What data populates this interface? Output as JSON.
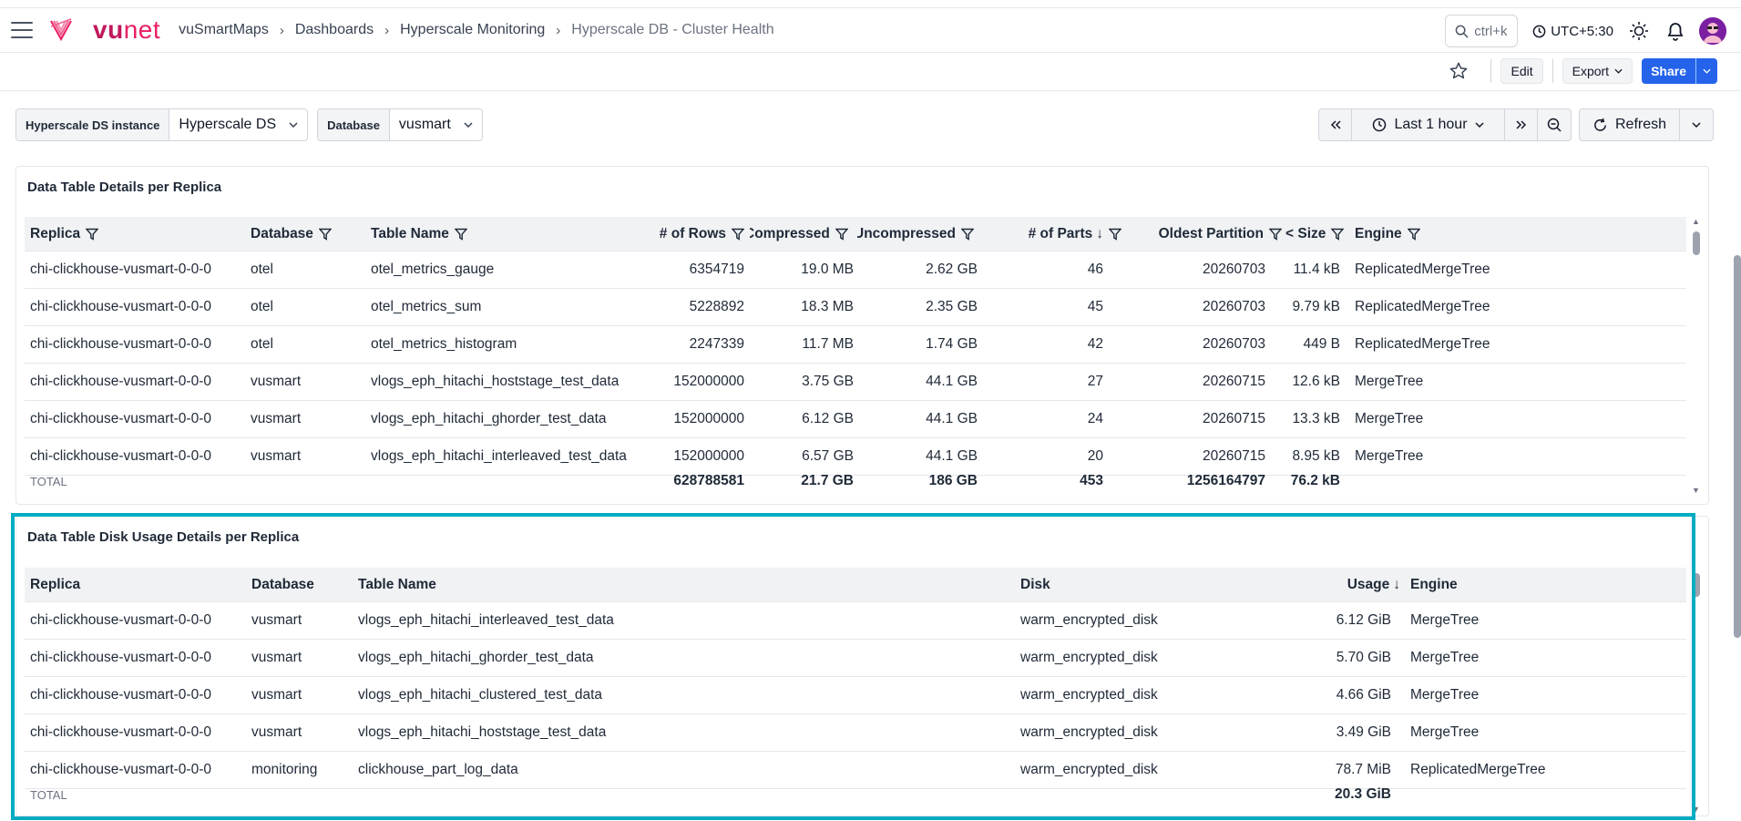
{
  "brand": {
    "name_a": "vu",
    "name_b": "net"
  },
  "breadcrumb": [
    "vuSmartMaps",
    "Dashboards",
    "Hyperscale Monitoring",
    "Hyperscale DB - Cluster Health"
  ],
  "topbar": {
    "search_hint": "ctrl+k",
    "timezone": "UTC+5:30"
  },
  "toolbar": {
    "edit": "Edit",
    "export": "Export",
    "share": "Share"
  },
  "filters": [
    {
      "label": "Hyperscale DS instance",
      "value": "Hyperscale DS"
    },
    {
      "label": "Database",
      "value": "vusmart"
    }
  ],
  "time": {
    "range": "Last 1 hour",
    "refresh": "Refresh"
  },
  "panel1": {
    "title": "Data Table Details per Replica",
    "headers": [
      "Replica",
      "Database",
      "Table Name",
      "# of Rows",
      "Compressed",
      "Uncompressed",
      "# of Parts",
      "Oldest Partition",
      "< Size",
      "Engine"
    ],
    "rows": [
      [
        "chi-clickhouse-vusmart-0-0-0",
        "otel",
        "otel_metrics_gauge",
        "6354719",
        "19.0 MB",
        "2.62 GB",
        "46",
        "20260703",
        "11.4 kB",
        "ReplicatedMergeTree"
      ],
      [
        "chi-clickhouse-vusmart-0-0-0",
        "otel",
        "otel_metrics_sum",
        "5228892",
        "18.3 MB",
        "2.35 GB",
        "45",
        "20260703",
        "9.79 kB",
        "ReplicatedMergeTree"
      ],
      [
        "chi-clickhouse-vusmart-0-0-0",
        "otel",
        "otel_metrics_histogram",
        "2247339",
        "11.7 MB",
        "1.74 GB",
        "42",
        "20260703",
        "449 B",
        "ReplicatedMergeTree"
      ],
      [
        "chi-clickhouse-vusmart-0-0-0",
        "vusmart",
        "vlogs_eph_hitachi_hoststage_test_data",
        "152000000",
        "3.75 GB",
        "44.1 GB",
        "27",
        "20260715",
        "12.6 kB",
        "MergeTree"
      ],
      [
        "chi-clickhouse-vusmart-0-0-0",
        "vusmart",
        "vlogs_eph_hitachi_ghorder_test_data",
        "152000000",
        "6.12 GB",
        "44.1 GB",
        "24",
        "20260715",
        "13.3 kB",
        "MergeTree"
      ],
      [
        "chi-clickhouse-vusmart-0-0-0",
        "vusmart",
        "vlogs_eph_hitachi_interleaved_test_data",
        "152000000",
        "6.57 GB",
        "44.1 GB",
        "20",
        "20260715",
        "8.95 kB",
        "MergeTree"
      ]
    ],
    "total": {
      "label": "TOTAL",
      "rows": "628788581",
      "compressed": "21.7 GB",
      "uncompressed": "186 GB",
      "parts": "453",
      "oldest": "1256164797",
      "size": "76.2 kB"
    }
  },
  "panel2": {
    "title": "Data Table Disk Usage Details per Replica",
    "headers": [
      "Replica",
      "Database",
      "Table Name",
      "Disk",
      "Usage",
      "Engine"
    ],
    "rows": [
      [
        "chi-clickhouse-vusmart-0-0-0",
        "vusmart",
        "vlogs_eph_hitachi_interleaved_test_data",
        "warm_encrypted_disk",
        "6.12 GiB",
        "MergeTree"
      ],
      [
        "chi-clickhouse-vusmart-0-0-0",
        "vusmart",
        "vlogs_eph_hitachi_ghorder_test_data",
        "warm_encrypted_disk",
        "5.70 GiB",
        "MergeTree"
      ],
      [
        "chi-clickhouse-vusmart-0-0-0",
        "vusmart",
        "vlogs_eph_hitachi_clustered_test_data",
        "warm_encrypted_disk",
        "4.66 GiB",
        "MergeTree"
      ],
      [
        "chi-clickhouse-vusmart-0-0-0",
        "vusmart",
        "vlogs_eph_hitachi_hoststage_test_data",
        "warm_encrypted_disk",
        "3.49 GiB",
        "MergeTree"
      ],
      [
        "chi-clickhouse-vusmart-0-0-0",
        "monitoring",
        "clickhouse_part_log_data",
        "warm_encrypted_disk",
        "78.7 MiB",
        "ReplicatedMergeTree"
      ]
    ],
    "total": {
      "label": "TOTAL",
      "usage": "20.3 GiB"
    }
  },
  "colors": {
    "brand": "#c2185b",
    "accent": "#2563eb",
    "highlight": "#00acc1"
  }
}
